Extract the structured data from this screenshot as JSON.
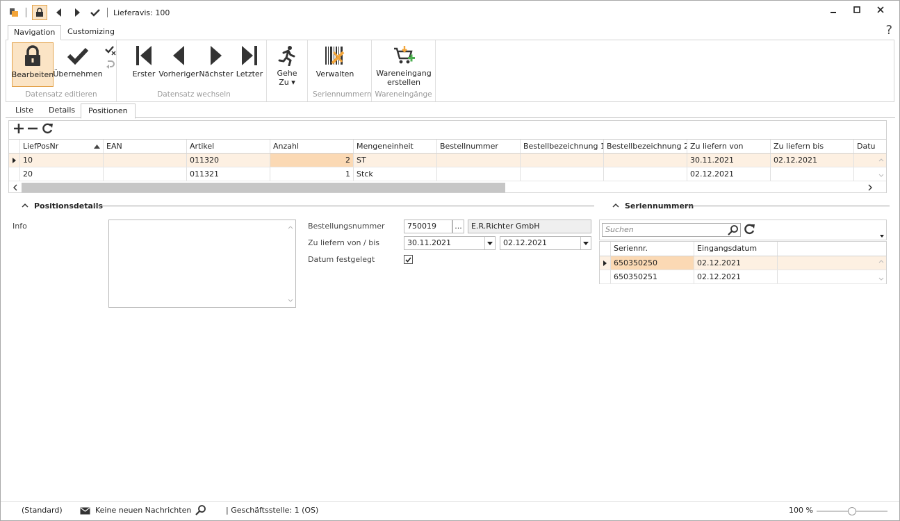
{
  "window": {
    "title": "Lieferavis: 100"
  },
  "ribbon_tabs": [
    "Navigation",
    "Customizing"
  ],
  "help": "?",
  "ribbon": {
    "groups": {
      "edit": "Datensatz editieren",
      "nav": "Datensatz wechseln",
      "serial": "Seriennummern",
      "receipt": "Wareneingänge"
    },
    "buttons": {
      "bearbeiten": "Bearbeiten",
      "uebernehmen": "Übernehmen",
      "erster": "Erster",
      "vorheriger": "Vorheriger",
      "naechster": "Nächster",
      "letzter": "Letzter",
      "gehe_line1": "Gehe",
      "gehe_line2": "Zu ▾",
      "verwalten": "Verwalten",
      "wareneingang_line1": "Wareneingang",
      "wareneingang_line2": "erstellen"
    }
  },
  "sub_tabs": [
    "Liste",
    "Details",
    "Positionen"
  ],
  "grid": {
    "columns": [
      "LiefPosNr",
      "EAN",
      "Artikel",
      "Anzahl",
      "Mengeneinheit",
      "Bestellnummer",
      "Bestellbezeichnung 1",
      "Bestellbezeichnung 2",
      "Zu liefern von",
      "Zu liefern bis",
      "Datu"
    ],
    "rows": [
      [
        "10",
        "",
        "011320",
        "2",
        "ST",
        "",
        "",
        "",
        "30.11.2021",
        "02.12.2021",
        ""
      ],
      [
        "20",
        "",
        "011321",
        "1",
        "Stck",
        "",
        "",
        "",
        "02.12.2021",
        "",
        ""
      ]
    ]
  },
  "details": {
    "title": "Positionsdetails",
    "info_label": "Info",
    "bestellnummer_label": "Bestellungsnummer",
    "bestellnummer_value": "750019",
    "browse": "...",
    "supplier": "E.R.Richter GmbH",
    "zu_liefern_label": "Zu liefern von / bis",
    "von": "30.11.2021",
    "bis": "02.12.2021",
    "datum_label": "Datum festgelegt",
    "datum_checked": true
  },
  "serials": {
    "title": "Seriennummern",
    "search_placeholder": "Suchen",
    "columns": [
      "Seriennr.",
      "Eingangsdatum"
    ],
    "rows": [
      [
        "650350250",
        "02.12.2021"
      ],
      [
        "650350251",
        "02.12.2021"
      ]
    ]
  },
  "status": {
    "layout": "(Standard)",
    "messages": "Keine neuen Nachrichten",
    "branch": "| Geschäftsstelle:  1 (OS)",
    "zoom": "100 %",
    "zoom_fraction": 0.5
  }
}
